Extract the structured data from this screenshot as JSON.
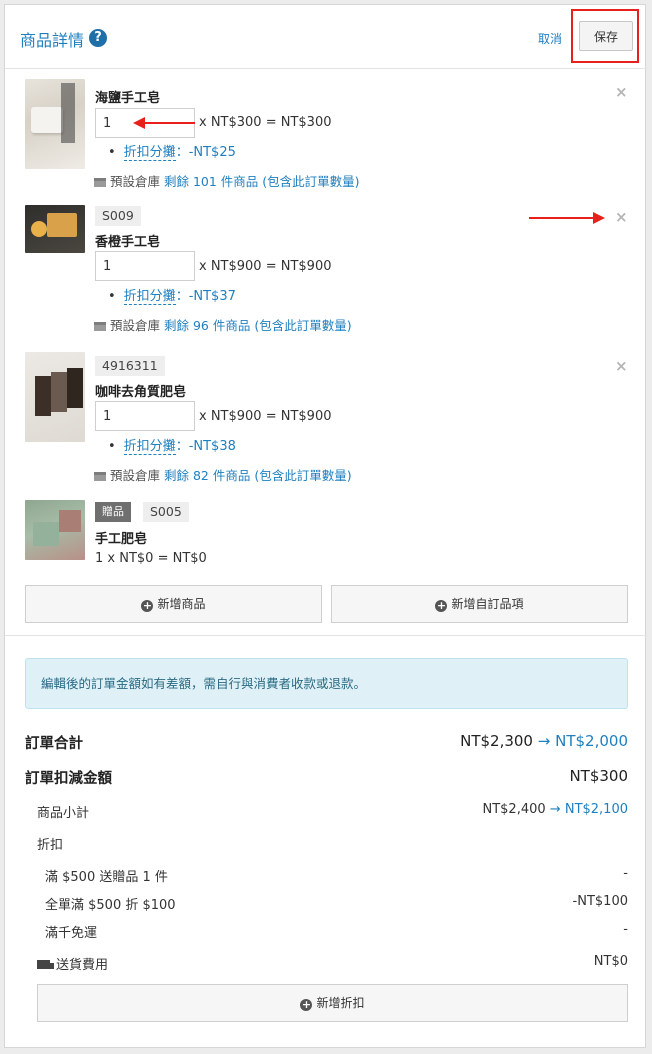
{
  "header": {
    "title": "商品詳情",
    "help_icon": "?",
    "cancel_label": "取消",
    "save_label": "保存"
  },
  "items": [
    {
      "name": "海鹽手工皂",
      "sku": "",
      "quantity": "1",
      "price_line": "x NT$300 = NT$300",
      "discount_label": "折扣分攤",
      "discount_value": "：-NT$25",
      "warehouse": "預設倉庫",
      "stock": "剩餘 101 件商品 (包含此訂單數量)",
      "remove_icon": "×",
      "thumb_colors": [
        "#d9d4cc",
        "#eeeeea"
      ]
    },
    {
      "name": "香橙手工皂",
      "sku": "S009",
      "quantity": "1",
      "price_line": "x NT$900 = NT$900",
      "discount_label": "折扣分攤",
      "discount_value": "：-NT$37",
      "warehouse": "預設倉庫",
      "stock": "剩餘 96 件商品 (包含此訂單數量)",
      "remove_icon": "×",
      "thumb_colors": [
        "#3b3a36",
        "#d79a3c"
      ]
    },
    {
      "name": "咖啡去角質肥皂",
      "sku": "4916311",
      "quantity": "1",
      "price_line": "x NT$900 = NT$900",
      "discount_label": "折扣分攤",
      "discount_value": "：-NT$38",
      "warehouse": "預設倉庫",
      "stock": "剩餘 82 件商品 (包含此訂單數量)",
      "remove_icon": "×",
      "thumb_colors": [
        "#e6e3de",
        "#4a3a30"
      ]
    },
    {
      "name": "手工肥皂",
      "gift_badge": "贈品",
      "sku": "S005",
      "price_line": "1 x NT$0 = NT$0",
      "thumb_colors": [
        "#9fb5a2",
        "#b58f84"
      ]
    }
  ],
  "buttons": {
    "add_product": "新增商品",
    "add_custom_item": "新增自訂品項",
    "add_discount": "新增折扣",
    "plus_icon": "+"
  },
  "notice": "編輯後的訂單金額如有差額，需自行與消費者收款或退款。",
  "summary": {
    "order_total_label": "訂單合計",
    "order_total_old": "NT$2,300",
    "order_total_new": "NT$2,000",
    "order_deduction_label": "訂單扣減金額",
    "order_deduction_value": "NT$300",
    "subtotal_label": "商品小計",
    "subtotal_old": "NT$2,400",
    "subtotal_new": "NT$2,100",
    "discount_label": "折扣",
    "discounts": [
      {
        "label": "滿 $500 送贈品 1 件",
        "value": "-"
      },
      {
        "label": "全單滿 $500 折 $100",
        "value": "-NT$100"
      },
      {
        "label": "滿千免運",
        "value": "-"
      }
    ],
    "shipping_label": "送貨費用",
    "shipping_value": "NT$0",
    "arrow": "→"
  },
  "colors": {
    "accent_blue": "#1f7fbf",
    "highlight_red": "#e8201b",
    "notice_bg": "#dff1f6"
  }
}
